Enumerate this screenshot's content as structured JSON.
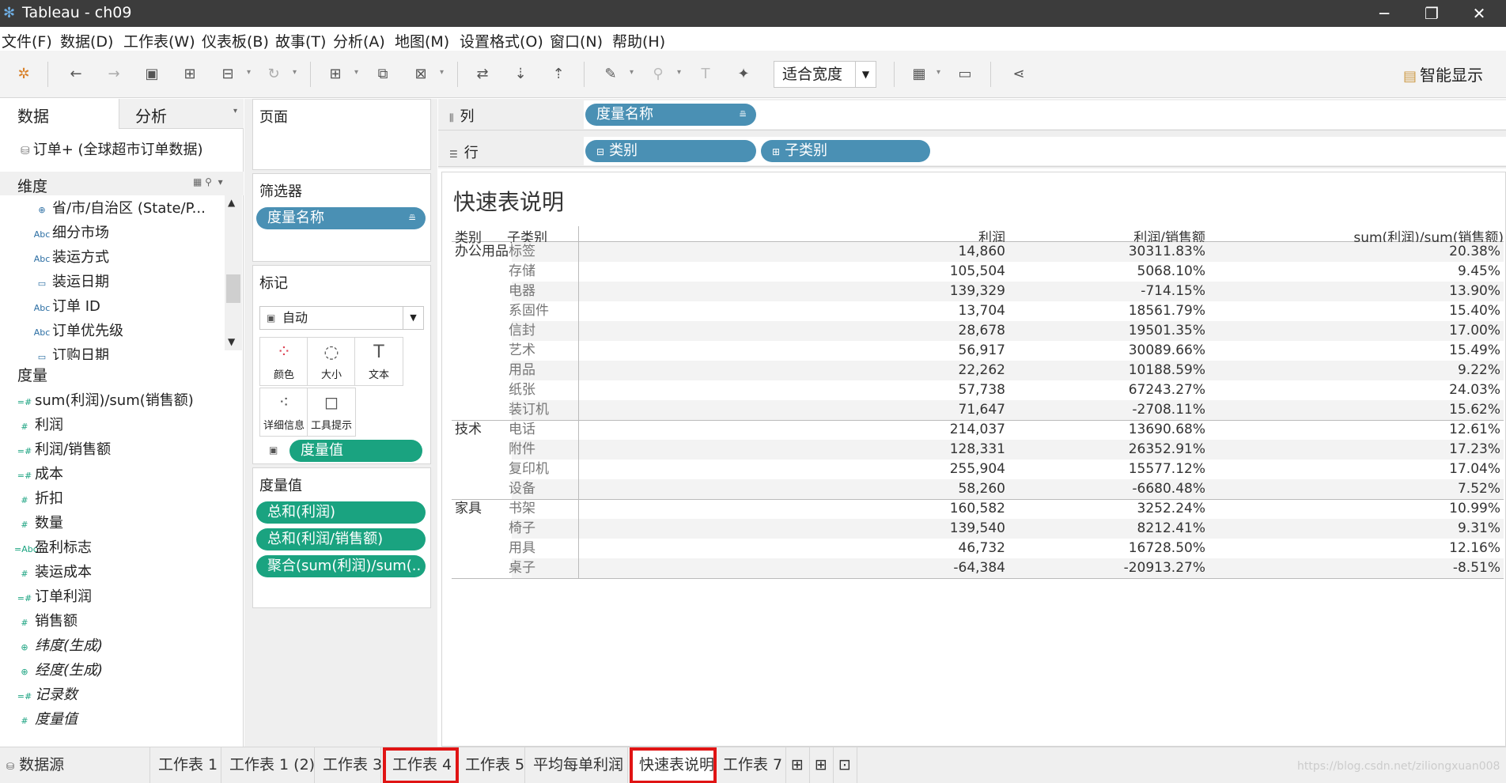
{
  "window": {
    "title": "Tableau - ch09",
    "minimize": "─",
    "restore": "❐",
    "close": "✕"
  },
  "menu": [
    "文件(F)",
    "数据(D)",
    "工作表(W)",
    "仪表板(B)",
    "故事(T)",
    "分析(A)",
    "地图(M)",
    "设置格式(O)",
    "窗口(N)",
    "帮助(H)"
  ],
  "toolbar": {
    "fit": "适合宽度",
    "smart_show": "智能显示"
  },
  "datapane": {
    "tab_data": "数据",
    "tab_analysis": "分析",
    "source": "订单+ (全球超市订单数据)",
    "dims_label": "维度",
    "dims": [
      {
        "icon": "⊕",
        "label": "省/市/自治区 (State/P..."
      },
      {
        "icon": "Abc",
        "label": "细分市场"
      },
      {
        "icon": "Abc",
        "label": "装运方式"
      },
      {
        "icon": "▭",
        "label": "装运日期"
      },
      {
        "icon": "Abc",
        "label": "订单 ID"
      },
      {
        "icon": "Abc",
        "label": "订单优先级"
      },
      {
        "icon": "▭",
        "label": "订购日期"
      }
    ],
    "meas_label": "度量",
    "measures": [
      {
        "icon": "=#",
        "label": "sum(利润)/sum(销售额)",
        "italic": false
      },
      {
        "icon": "#",
        "label": "利润",
        "italic": false
      },
      {
        "icon": "=#",
        "label": "利润/销售额",
        "italic": false
      },
      {
        "icon": "=#",
        "label": "成本",
        "italic": false
      },
      {
        "icon": "#",
        "label": "折扣",
        "italic": false
      },
      {
        "icon": "#",
        "label": "数量",
        "italic": false
      },
      {
        "icon": "=Abc",
        "label": "盈利标志",
        "italic": false
      },
      {
        "icon": "#",
        "label": "装运成本",
        "italic": false
      },
      {
        "icon": "=#",
        "label": "订单利润",
        "italic": false
      },
      {
        "icon": "#",
        "label": "销售额",
        "italic": false
      },
      {
        "icon": "⊕",
        "label": "纬度(生成)",
        "italic": true
      },
      {
        "icon": "⊕",
        "label": "经度(生成)",
        "italic": true
      },
      {
        "icon": "=#",
        "label": "记录数",
        "italic": true
      },
      {
        "icon": "#",
        "label": "度量值",
        "italic": true
      }
    ]
  },
  "cards": {
    "pages": "页面",
    "filters": "筛选器",
    "filter_pill": "度量名称",
    "marks": "标记",
    "marks_type": "自动",
    "mark_color": "颜色",
    "mark_size": "大小",
    "mark_text": "文本",
    "mark_detail": "详细信息",
    "mark_tooltip": "工具提示",
    "marks_pill": "度量值",
    "measure_values": "度量值",
    "mv_pills": [
      "总和(利润)",
      "总和(利润/销售额)",
      "聚合(sum(利润)/sum(.."
    ]
  },
  "shelves": {
    "columns_label": "列",
    "rows_label": "行",
    "columns_pill": "度量名称",
    "rows_pills": [
      "类别",
      "子类别"
    ]
  },
  "view": {
    "title": "快速表说明",
    "headers": [
      "类别",
      "子类别",
      "利润",
      "利润/销售额",
      "sum(利润)/sum(销售额)"
    ],
    "groups": [
      {
        "category": "办公用品",
        "rows": [
          [
            "标签",
            "14,860",
            "30311.83%",
            "20.38%"
          ],
          [
            "存储",
            "105,504",
            "5068.10%",
            "9.45%"
          ],
          [
            "电器",
            "139,329",
            "-714.15%",
            "13.90%"
          ],
          [
            "系固件",
            "13,704",
            "18561.79%",
            "15.40%"
          ],
          [
            "信封",
            "28,678",
            "19501.35%",
            "17.00%"
          ],
          [
            "艺术",
            "56,917",
            "30089.66%",
            "15.49%"
          ],
          [
            "用品",
            "22,262",
            "10188.59%",
            "9.22%"
          ],
          [
            "纸张",
            "57,738",
            "67243.27%",
            "24.03%"
          ],
          [
            "装订机",
            "71,647",
            "-2708.11%",
            "15.62%"
          ]
        ]
      },
      {
        "category": "技术",
        "rows": [
          [
            "电话",
            "214,037",
            "13690.68%",
            "12.61%"
          ],
          [
            "附件",
            "128,331",
            "26352.91%",
            "17.23%"
          ],
          [
            "复印机",
            "255,904",
            "15577.12%",
            "17.04%"
          ],
          [
            "设备",
            "58,260",
            "-6680.48%",
            "7.52%"
          ]
        ]
      },
      {
        "category": "家具",
        "rows": [
          [
            "书架",
            "160,582",
            "3252.24%",
            "10.99%"
          ],
          [
            "椅子",
            "139,540",
            "8212.41%",
            "9.31%"
          ],
          [
            "用具",
            "46,732",
            "16728.50%",
            "12.16%"
          ],
          [
            "桌子",
            "-64,384",
            "-20913.27%",
            "-8.51%"
          ]
        ]
      }
    ]
  },
  "tabs": {
    "datasource": "数据源",
    "sheets": [
      "工作表 1",
      "工作表 1 (2)",
      "工作表 3",
      "工作表 4",
      "工作表 5",
      "平均每单利润",
      "快速表说明",
      "工作表 7"
    ],
    "highlighted": [
      "工作表 4",
      "快速表说明"
    ],
    "active": "快速表说明",
    "watermark": "https://blog.csdn.net/ziliongxuan008"
  },
  "colors": {
    "dimension_pill": "#4a90b4",
    "measure_pill": "#1aa380",
    "highlight": "#e01414"
  }
}
